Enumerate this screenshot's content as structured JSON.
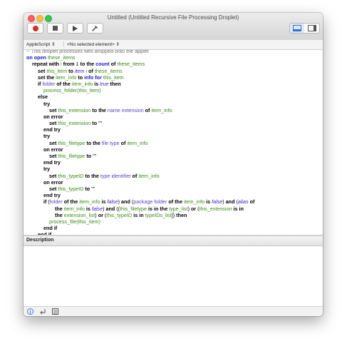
{
  "window": {
    "title": "Untitled (Untitled Recursive File Processing Droplet)"
  },
  "toolbar": {
    "record_icon": "record-icon",
    "stop_icon": "stop-icon",
    "run_icon": "play-icon",
    "compile_icon": "hammer-icon",
    "view_icons": [
      "editor-view-icon",
      "sidebar-view-icon"
    ]
  },
  "navigation": {
    "language": "AppleScript",
    "element": "<No selected element>"
  },
  "script": {
    "lines": [
      [
        [
          "cm",
          "-- This droplet processes files dropped onto the applet"
        ]
      ],
      [
        [
          "op",
          "on open"
        ],
        [
          "t",
          " "
        ],
        [
          "var",
          "these_items"
        ]
      ],
      [
        [
          "t",
          "    "
        ],
        [
          "kw",
          "repeat with"
        ],
        [
          "t",
          " "
        ],
        [
          "var",
          "i"
        ],
        [
          "t",
          " "
        ],
        [
          "kw",
          "from"
        ],
        [
          "t",
          " 1 "
        ],
        [
          "kw",
          "to the"
        ],
        [
          "t",
          " "
        ],
        [
          "op",
          "count"
        ],
        [
          "t",
          " "
        ],
        [
          "kw",
          "of"
        ],
        [
          "t",
          " "
        ],
        [
          "var",
          "these_items"
        ]
      ],
      [
        [
          "t",
          "        "
        ],
        [
          "kw",
          "set"
        ],
        [
          "t",
          " "
        ],
        [
          "var",
          "this_item"
        ],
        [
          "t",
          " "
        ],
        [
          "kw",
          "to"
        ],
        [
          "t",
          " "
        ],
        [
          "it",
          "item"
        ],
        [
          "t",
          " "
        ],
        [
          "var",
          "i"
        ],
        [
          "t",
          " "
        ],
        [
          "kw",
          "of"
        ],
        [
          "t",
          " "
        ],
        [
          "var",
          "these_items"
        ]
      ],
      [
        [
          "t",
          "        "
        ],
        [
          "kw",
          "set the"
        ],
        [
          "t",
          " "
        ],
        [
          "var",
          "item_info"
        ],
        [
          "t",
          " "
        ],
        [
          "kw",
          "to"
        ],
        [
          "t",
          " "
        ],
        [
          "op",
          "info for"
        ],
        [
          "t",
          " "
        ],
        [
          "var",
          "this_item"
        ]
      ],
      [
        [
          "t",
          "        "
        ],
        [
          "kw",
          "if"
        ],
        [
          "t",
          " "
        ],
        [
          "prop",
          "folder"
        ],
        [
          "t",
          " "
        ],
        [
          "kw",
          "of the"
        ],
        [
          "t",
          " "
        ],
        [
          "var",
          "item_info"
        ],
        [
          "t",
          " "
        ],
        [
          "kw",
          "is"
        ],
        [
          "t",
          " "
        ],
        [
          "it",
          "true"
        ],
        [
          "t",
          " "
        ],
        [
          "kw",
          "then"
        ]
      ],
      [
        [
          "t",
          "            "
        ],
        [
          "var",
          "process_folder(this_item)"
        ]
      ],
      [
        [
          "t",
          "        "
        ],
        [
          "kw",
          "else"
        ]
      ],
      [
        [
          "t",
          "            "
        ],
        [
          "kw",
          "try"
        ]
      ],
      [
        [
          "t",
          "                "
        ],
        [
          "kw",
          "set"
        ],
        [
          "t",
          " "
        ],
        [
          "var",
          "this_extension"
        ],
        [
          "t",
          " "
        ],
        [
          "kw",
          "to the"
        ],
        [
          "t",
          " "
        ],
        [
          "prop",
          "name extension"
        ],
        [
          "t",
          " "
        ],
        [
          "kw",
          "of"
        ],
        [
          "t",
          " "
        ],
        [
          "var",
          "item_info"
        ]
      ],
      [
        [
          "t",
          "            "
        ],
        [
          "kw",
          "on error"
        ]
      ],
      [
        [
          "t",
          "                "
        ],
        [
          "kw",
          "set"
        ],
        [
          "t",
          " "
        ],
        [
          "var",
          "this_extension"
        ],
        [
          "t",
          " "
        ],
        [
          "kw",
          "to"
        ],
        [
          "t",
          " \"\""
        ]
      ],
      [
        [
          "t",
          "            "
        ],
        [
          "kw",
          "end try"
        ]
      ],
      [
        [
          "t",
          "            "
        ],
        [
          "kw",
          "try"
        ]
      ],
      [
        [
          "t",
          "                "
        ],
        [
          "kw",
          "set"
        ],
        [
          "t",
          " "
        ],
        [
          "var",
          "this_filetype"
        ],
        [
          "t",
          " "
        ],
        [
          "kw",
          "to the"
        ],
        [
          "t",
          " "
        ],
        [
          "prop",
          "file type"
        ],
        [
          "t",
          " "
        ],
        [
          "kw",
          "of"
        ],
        [
          "t",
          " "
        ],
        [
          "var",
          "item_info"
        ]
      ],
      [
        [
          "t",
          "            "
        ],
        [
          "kw",
          "on error"
        ]
      ],
      [
        [
          "t",
          "                "
        ],
        [
          "kw",
          "set"
        ],
        [
          "t",
          " "
        ],
        [
          "var",
          "this_filetype"
        ],
        [
          "t",
          " "
        ],
        [
          "kw",
          "to"
        ],
        [
          "t",
          " \"\""
        ]
      ],
      [
        [
          "t",
          "            "
        ],
        [
          "kw",
          "end try"
        ]
      ],
      [
        [
          "t",
          "            "
        ],
        [
          "kw",
          "try"
        ]
      ],
      [
        [
          "t",
          "                "
        ],
        [
          "kw",
          "set"
        ],
        [
          "t",
          " "
        ],
        [
          "var",
          "this_typeID"
        ],
        [
          "t",
          " "
        ],
        [
          "kw",
          "to the"
        ],
        [
          "t",
          " "
        ],
        [
          "prop",
          "type identifier"
        ],
        [
          "t",
          " "
        ],
        [
          "kw",
          "of"
        ],
        [
          "t",
          " "
        ],
        [
          "var",
          "item_info"
        ]
      ],
      [
        [
          "t",
          "            "
        ],
        [
          "kw",
          "on error"
        ]
      ],
      [
        [
          "t",
          "                "
        ],
        [
          "kw",
          "set"
        ],
        [
          "t",
          " "
        ],
        [
          "var",
          "this_typeID"
        ],
        [
          "t",
          " "
        ],
        [
          "kw",
          "to"
        ],
        [
          "t",
          " \"\""
        ]
      ],
      [
        [
          "t",
          "            "
        ],
        [
          "kw",
          "end try"
        ]
      ],
      [
        [
          "t",
          "            "
        ],
        [
          "kw",
          "if"
        ],
        [
          "t",
          " ("
        ],
        [
          "prop",
          "folder"
        ],
        [
          "t",
          " "
        ],
        [
          "kw",
          "of the"
        ],
        [
          "t",
          " "
        ],
        [
          "var",
          "item_info"
        ],
        [
          "t",
          " "
        ],
        [
          "kw",
          "is"
        ],
        [
          "t",
          " "
        ],
        [
          "it",
          "false"
        ],
        [
          "t",
          ") "
        ],
        [
          "kw",
          "and"
        ],
        [
          "t",
          " ("
        ],
        [
          "prop",
          "package folder"
        ],
        [
          "t",
          " "
        ],
        [
          "kw",
          "of the"
        ],
        [
          "t",
          " "
        ],
        [
          "var",
          "item_info"
        ],
        [
          "t",
          " "
        ],
        [
          "kw",
          "is"
        ],
        [
          "t",
          " "
        ],
        [
          "it",
          "false"
        ],
        [
          "t",
          ") "
        ],
        [
          "kw",
          "and"
        ],
        [
          "t",
          " ("
        ],
        [
          "it",
          "alias"
        ],
        [
          "t",
          " "
        ],
        [
          "kw",
          "of"
        ]
      ],
      [
        [
          "t",
          "                    "
        ],
        [
          "kw",
          "the"
        ],
        [
          "t",
          " "
        ],
        [
          "var",
          "item_info"
        ],
        [
          "t",
          " "
        ],
        [
          "kw",
          "is"
        ],
        [
          "t",
          " "
        ],
        [
          "it",
          "false"
        ],
        [
          "t",
          ") "
        ],
        [
          "kw",
          "and"
        ],
        [
          "t",
          " (("
        ],
        [
          "var",
          "this_filetype"
        ],
        [
          "t",
          " "
        ],
        [
          "kw",
          "is in the"
        ],
        [
          "t",
          " "
        ],
        [
          "var",
          "type_list"
        ],
        [
          "t",
          ") "
        ],
        [
          "kw",
          "or"
        ],
        [
          "t",
          " ("
        ],
        [
          "var",
          "this_extension"
        ],
        [
          "t",
          " "
        ],
        [
          "kw",
          "is in"
        ]
      ],
      [
        [
          "t",
          "                    "
        ],
        [
          "kw",
          "the"
        ],
        [
          "t",
          " "
        ],
        [
          "var",
          "extension_list"
        ],
        [
          "t",
          ") "
        ],
        [
          "kw",
          "or"
        ],
        [
          "t",
          " ("
        ],
        [
          "var",
          "this_typeID"
        ],
        [
          "t",
          " "
        ],
        [
          "kw",
          "is in"
        ],
        [
          "t",
          " "
        ],
        [
          "var",
          "typeIDs_list"
        ],
        [
          "t",
          "]) "
        ],
        [
          "kw",
          "then"
        ]
      ],
      [
        [
          "t",
          "                "
        ],
        [
          "var",
          "process_file(this_item)"
        ]
      ],
      [
        [
          "t",
          "            "
        ],
        [
          "kw",
          "end if"
        ]
      ],
      [
        [
          "t",
          "        "
        ],
        [
          "kw",
          "end if"
        ]
      ]
    ]
  },
  "description": {
    "label": "Description"
  },
  "bottombar": {
    "icons": [
      "info-icon",
      "reply-icon",
      "log-icon"
    ]
  }
}
